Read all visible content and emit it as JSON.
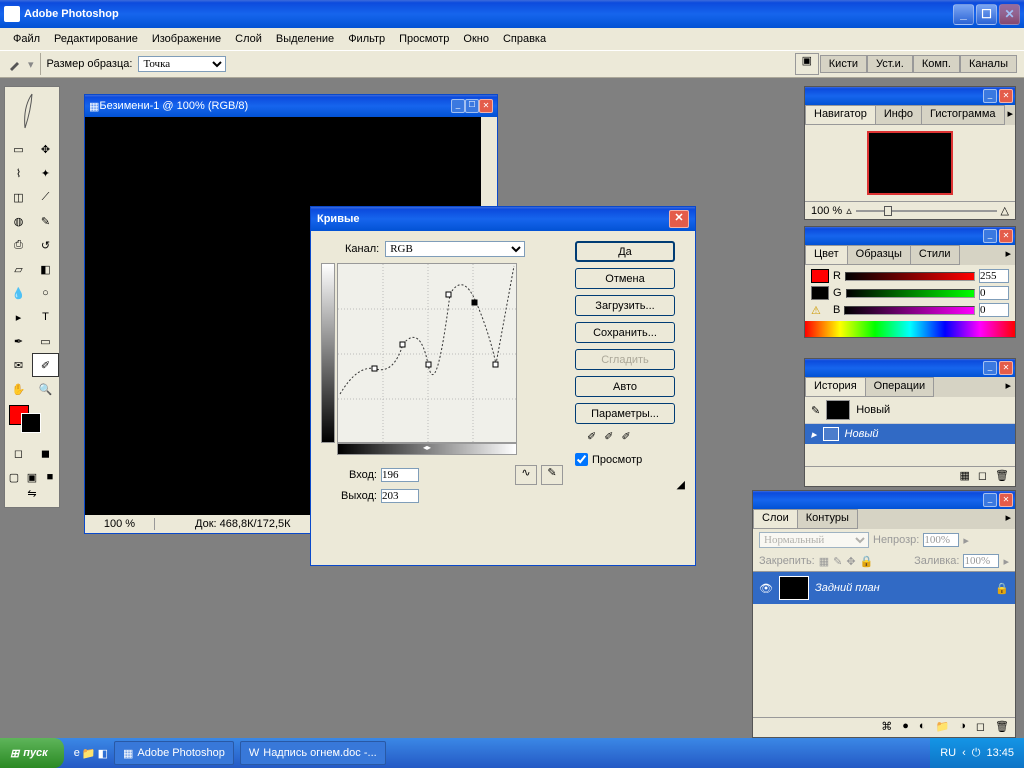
{
  "app": {
    "title": "Adobe Photoshop"
  },
  "menu": [
    "Файл",
    "Редактирование",
    "Изображение",
    "Слой",
    "Выделение",
    "Фильтр",
    "Просмотр",
    "Окно",
    "Справка"
  ],
  "options": {
    "sample_label": "Размер образца:",
    "sample_value": "Точка",
    "dock_tabs": [
      "Кисти",
      "Уст.и.",
      "Комп.",
      "Каналы"
    ]
  },
  "doc": {
    "title": "Безимени-1 @ 100% (RGB/8)",
    "zoom": "100 %",
    "status": "Док: 468,8К/172,5К"
  },
  "curves": {
    "title": "Кривые",
    "channel_label": "Канал:",
    "channel_value": "RGB",
    "input_label": "Вход:",
    "input_value": "196",
    "output_label": "Выход:",
    "output_value": "203",
    "preview_label": "Просмотр",
    "buttons": {
      "ok": "Да",
      "cancel": "Отмена",
      "load": "Загрузить...",
      "save": "Сохранить...",
      "smooth": "Сгладить",
      "auto": "Авто",
      "options": "Параметры..."
    }
  },
  "navigator": {
    "tabs": [
      "Навигатор",
      "Инфо",
      "Гистограмма"
    ],
    "zoom": "100 %"
  },
  "color": {
    "tabs": [
      "Цвет",
      "Образцы",
      "Стили"
    ],
    "r": "255",
    "g": "0",
    "b": "0",
    "labels": [
      "R",
      "G",
      "B"
    ]
  },
  "history": {
    "tabs": [
      "История",
      "Операции"
    ],
    "snapshot": "Новый",
    "state": "Новый"
  },
  "layers": {
    "tabs": [
      "Слои",
      "Контуры"
    ],
    "mode": "Нормальный",
    "opacity_label": "Непрозр:",
    "opacity": "100%",
    "lock_label": "Закрепить:",
    "fill_label": "Заливка:",
    "fill": "100%",
    "layer_name": "Задний план"
  },
  "taskbar": {
    "start": "пуск",
    "items": [
      "Adobe Photoshop",
      "Надпись огнем.doc -..."
    ],
    "lang": "RU",
    "time": "13:45"
  }
}
